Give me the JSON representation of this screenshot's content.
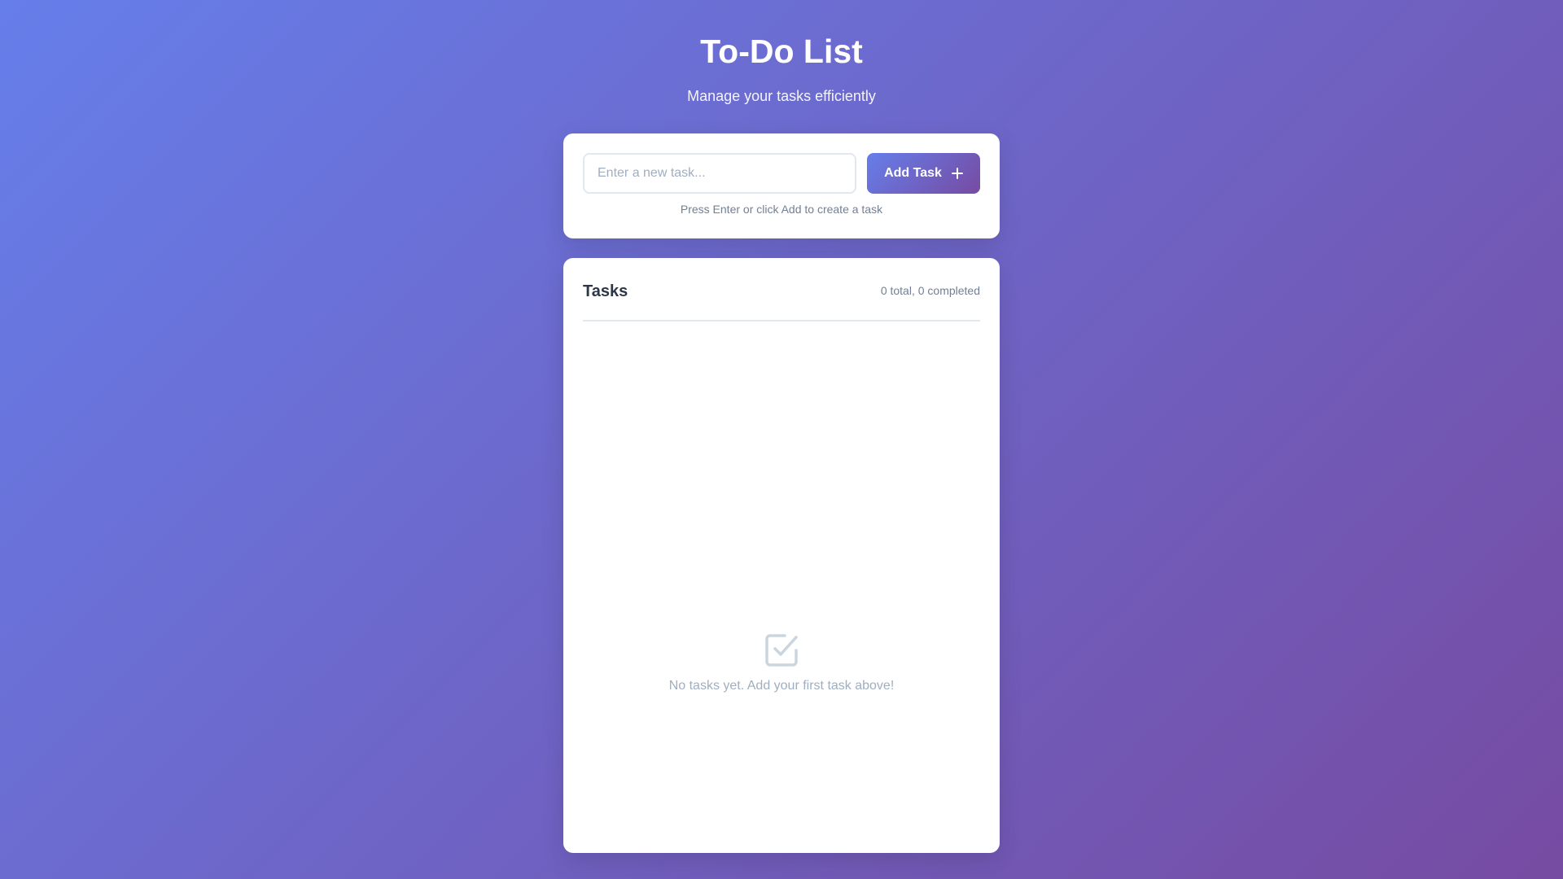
{
  "header": {
    "title": "To-Do List",
    "subtitle": "Manage your tasks efficiently"
  },
  "input_card": {
    "input_value": "",
    "input_placeholder": "Enter a new task...",
    "add_button_label": "Add Task",
    "add_button_icon": "plus-icon",
    "hint": "Press Enter or click Add to create a task"
  },
  "tasks": {
    "heading": "Tasks",
    "count_text": "0 total, 0 completed",
    "items": [],
    "empty_icon": "checkbox-check-icon",
    "empty_text": "No tasks yet. Add your first task above!"
  },
  "colors": {
    "gradient_start": "#667eea",
    "gradient_end": "#764ba2",
    "card_background": "#ffffff",
    "heading_text": "#2d3748",
    "muted_text": "#718096",
    "placeholder_text": "#a0aec0"
  }
}
